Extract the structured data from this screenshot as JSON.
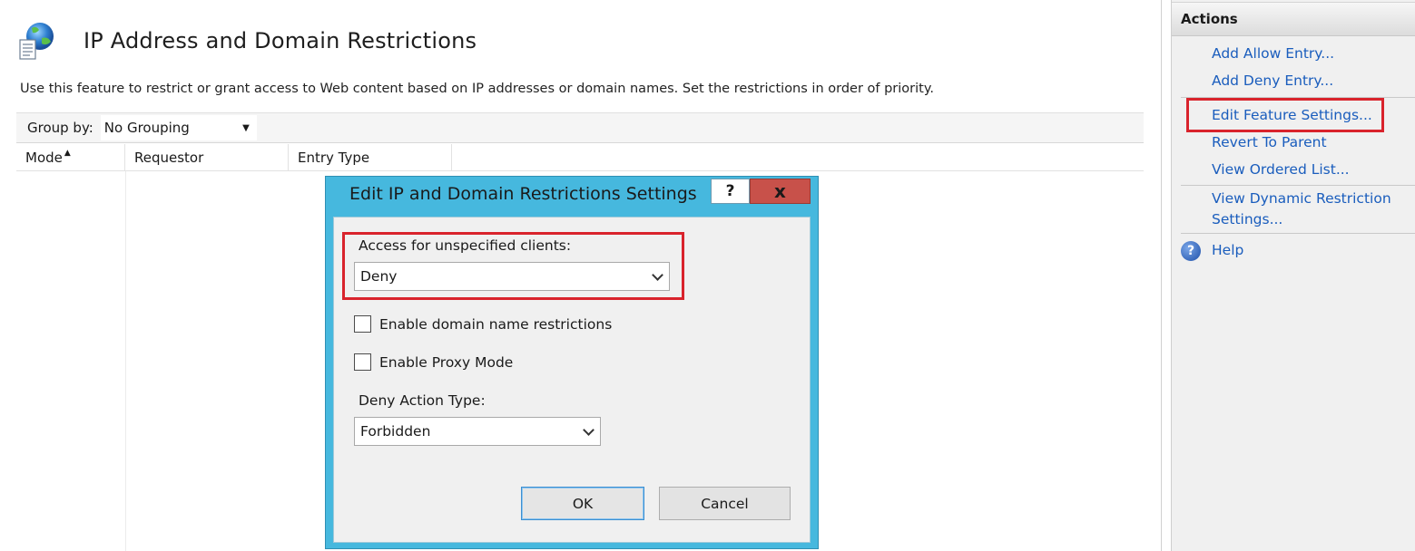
{
  "main": {
    "title": "IP Address and Domain Restrictions",
    "description": "Use this feature to restrict or grant access to Web content based on IP addresses or domain names. Set the restrictions in order of priority.",
    "group_by_label": "Group by:",
    "group_by_value": "No Grouping",
    "columns": [
      "Mode",
      "Requestor",
      "Entry Type"
    ]
  },
  "actions": {
    "header": "Actions",
    "items": [
      "Add Allow Entry...",
      "Add Deny Entry...",
      "Edit Feature Settings...",
      "Revert To Parent",
      "View Ordered List...",
      "View Dynamic Restriction",
      "Settings...",
      "Help"
    ]
  },
  "dialog": {
    "title": "Edit IP and Domain Restrictions Settings",
    "help_glyph": "?",
    "close_glyph": "x",
    "access_label": "Access for unspecified clients:",
    "access_value": "Deny",
    "domain_checkbox_label": "Enable domain name restrictions",
    "domain_checked": false,
    "proxy_checkbox_label": "Enable Proxy Mode",
    "proxy_checked": false,
    "deny_action_label": "Deny Action Type:",
    "deny_action_value": "Forbidden",
    "ok_label": "OK",
    "cancel_label": "Cancel"
  },
  "colors": {
    "dialog_frame": "#46b8de",
    "highlight": "#d9232c",
    "link": "#1a5dbd",
    "close_button": "#c8514a"
  }
}
